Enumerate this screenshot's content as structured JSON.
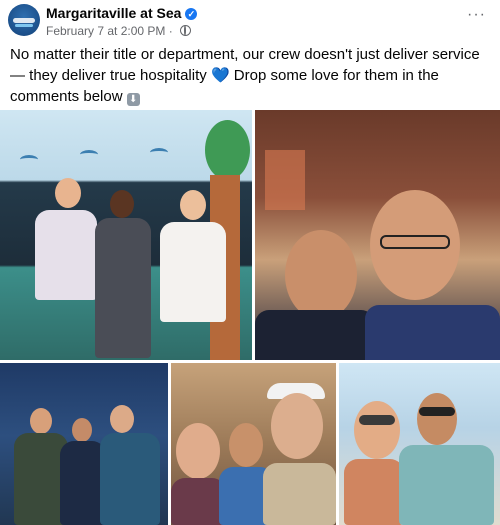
{
  "post": {
    "page_name": "Margaritaville at Sea",
    "date": "February 7 at 2:00 PM",
    "separator": "·",
    "more_label": "···",
    "caption_main": "No matter their title or department, our crew doesn't just deliver service — they deliver true hospitality",
    "caption_heart": "💙",
    "caption_tail": "Drop some love for them in the comments below",
    "caption_arrow": "⬇"
  },
  "icons": {
    "avatar": "margaritaville-logo",
    "verified": "verified-badge-icon",
    "privacy": "globe-icon",
    "more": "more-options-icon"
  },
  "colors": {
    "accent": "#1877f2",
    "meta_text": "#65676b",
    "heart": "#4da3f0"
  },
  "photos": [
    {
      "scene": "crew-photo-1"
    },
    {
      "scene": "crew-photo-2"
    },
    {
      "scene": "crew-photo-3"
    },
    {
      "scene": "crew-photo-4"
    },
    {
      "scene": "crew-photo-5"
    }
  ]
}
